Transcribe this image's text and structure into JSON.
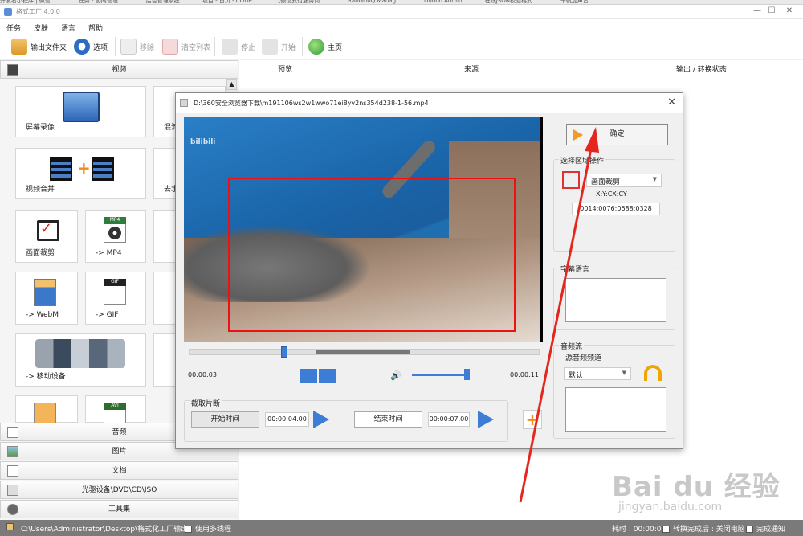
{
  "bookmarks": [
    "开发者小程序 | 微信...",
    "任务 - 协同管理...",
    "后台管理系统",
    "项目 - 首页 - CODE",
    "【微信支付服务商...",
    "RabbitMQ Manag...",
    "Dubbo Admin",
    "在线JSON校验格式...",
    "千帆加声音"
  ],
  "window": {
    "title": "格式工厂 4.0.0",
    "min": "—",
    "max": "☐",
    "close": "✕"
  },
  "menu": [
    "任务",
    "皮肤",
    "语言",
    "帮助"
  ],
  "toolbar": {
    "output_folder": "输出文件夹",
    "options": "选项",
    "remove": "移除",
    "clear_list": "清空列表",
    "stop": "停止",
    "start": "开始",
    "home": "主页"
  },
  "left_panel": {
    "video_header": "视频",
    "tiles": {
      "screen_record": "屏幕录像",
      "mix": "混流",
      "video_merge": "视频合并",
      "remove_watermark": "去水",
      "crop": "画面裁剪",
      "to_mp4": "-> MP4",
      "to_webm": "-> WebM",
      "to_gif": "-> GIF",
      "mobile": "-> 移动设备",
      "mp4_badge": "MP4",
      "gif_badge": "GIF",
      "avi_badge": "AVI"
    },
    "categories": [
      "音频",
      "图片",
      "文档",
      "光驱设备\\DVD\\CD\\ISO",
      "工具集"
    ],
    "scroll_up": "▲"
  },
  "list_header": {
    "preview": "预览",
    "source": "来源",
    "output_status": "输出 / 转换状态"
  },
  "status_bar": {
    "path": "C:\\Users\\Administrator\\Desktop\\格式化工厂输出",
    "multithread": "使用多线程",
    "elapsed": "耗时 : 00:00:00",
    "after_done": "转换完成后 : 关闭电脑",
    "notify": "完成通知"
  },
  "dialog": {
    "title": "D:\\360安全浏览器下载\\m191106ws2w1wwo71ei8yv2ns354d238-1-56.mp4",
    "close": "✕",
    "watermark_logo": "bilibili",
    "time_current": "00:00:03",
    "time_total": "00:00:11",
    "playback_position": 0.27,
    "selection_start": 0.36,
    "selection_end": 0.63,
    "volume_level": 1.0,
    "volume_icon": "🔊",
    "clip": {
      "header": "截取片断",
      "start_label": "开始时间",
      "start_value": "00:00:04.00",
      "end_label": "结束时间",
      "end_value": "00:00:07.00"
    },
    "add": "+",
    "ok": "确定",
    "region": {
      "header": "选择区域操作",
      "mode": "画面裁剪",
      "format": "X:Y:CX:CY",
      "value": "0014:0076:0688:0328"
    },
    "subtitle": {
      "header": "字幕语言"
    },
    "audio": {
      "header": "音频流",
      "channel_label": "源音频频道",
      "channel_value": "默认"
    }
  },
  "watermark": {
    "brand": "Bai du 经验",
    "url": "jingyan.baidu.com"
  }
}
